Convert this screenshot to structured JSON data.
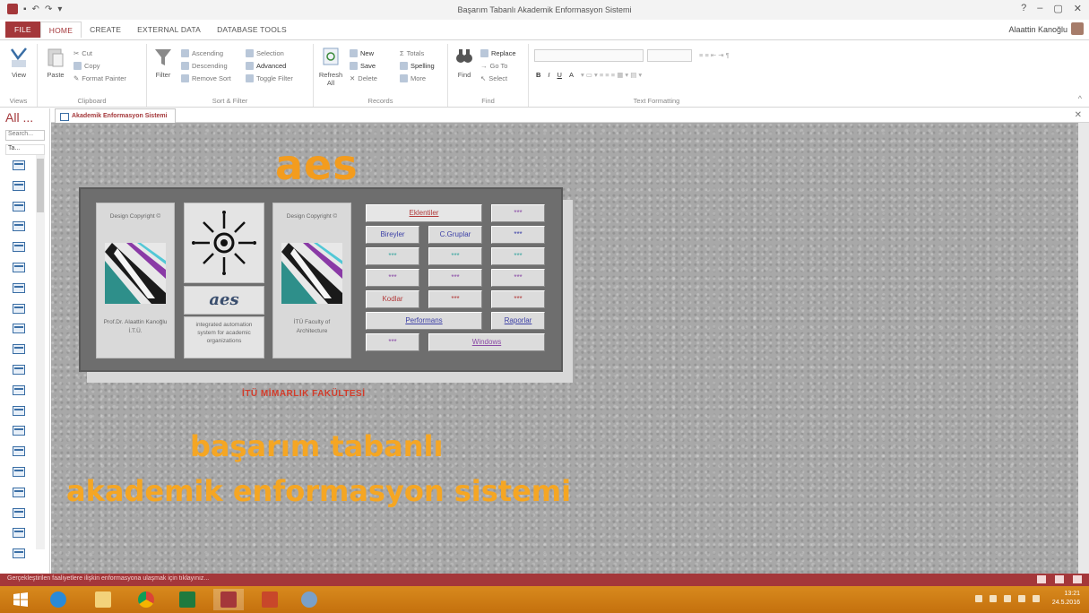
{
  "window": {
    "title": "Başarım Tabanlı Akademik Enformasyon Sistemi",
    "user": "Alaattin Kanoğlu",
    "controls": [
      "?",
      "–",
      "▢",
      "✕"
    ]
  },
  "ribbon_tabs": [
    "FILE",
    "HOME",
    "CREATE",
    "EXTERNAL DATA",
    "DATABASE TOOLS"
  ],
  "ribbon": {
    "views": {
      "view": "View",
      "label": "Views"
    },
    "clipboard": {
      "paste": "Paste",
      "cut": "Cut",
      "copy": "Copy",
      "format_painter": "Format Painter",
      "label": "Clipboard"
    },
    "sort_filter": {
      "filter": "Filter",
      "ascending": "Ascending",
      "descending": "Descending",
      "remove_sort": "Remove Sort",
      "selection": "Selection",
      "advanced": "Advanced",
      "toggle_filter": "Toggle Filter",
      "label": "Sort & Filter"
    },
    "records": {
      "refresh": "Refresh All",
      "new": "New",
      "save": "Save",
      "delete": "Delete",
      "totals": "Totals",
      "spelling": "Spelling",
      "more": "More",
      "label": "Records"
    },
    "find": {
      "find": "Find",
      "replace": "Replace",
      "goto": "Go To",
      "select": "Select",
      "label": "Find"
    },
    "text_formatting": {
      "bold": "B",
      "italic": "I",
      "underline": "U",
      "font_color": "A",
      "label": "Text Formatting"
    }
  },
  "nav": {
    "title": "All ...",
    "search_placeholder": "Search...",
    "group_label": "Ta...",
    "item_count": 20
  },
  "doc_tab": {
    "label": "Akademik Enformasyon Sistemi",
    "close": "✕"
  },
  "form": {
    "title": "aes",
    "card_left": {
      "top": "Design Copyright ©",
      "bottom": "Prof.Dr. Alaattin Kanoğlu İ.T.Ü."
    },
    "card_middle": {
      "logo_text": "aes",
      "bottom": "integrated automation system for academic organizations"
    },
    "card_right": {
      "top": "Design Copyright ©",
      "bottom": "İTÜ Faculty of Architecture"
    },
    "buttons": {
      "eklentiler": "Eklentiler",
      "btn_r1": "***",
      "bireyler": "Bireyler",
      "c_gruplar": "C.Gruplar",
      "btn_r2": "***",
      "btn_a": "***",
      "btn_b": "***",
      "btn_c": "***",
      "btn_d": "***",
      "btn_e": "***",
      "btn_f": "***",
      "kodlar": "Kodlar",
      "btn_g": "***",
      "btn_h": "***",
      "performans": "Performans",
      "raporlar": "Raporlar",
      "btn_i": "***",
      "windows": "Windows"
    },
    "faculty": "İTÜ MİMARLIK FAKÜLTESİ",
    "slogan_line1": "başarım tabanlı",
    "slogan_line2": "akademik enformasyon sistemi"
  },
  "status": {
    "text": "Gerçekleştirilen faaliyetlere ilişkin enformasyona ulaşmak için tıklayınız..."
  },
  "taskbar": {
    "clock_time": "13:21",
    "clock_date": "24.5.2016",
    "apps": [
      "start-icon",
      "ie-icon",
      "explorer-icon",
      "chrome-icon",
      "excel-icon",
      "access-icon",
      "powerpoint-icon",
      "media-icon"
    ]
  },
  "colors": {
    "access_red": "#a4373a",
    "aes_orange": "#f39c1e",
    "taskbar_orange": "#d88a1e"
  }
}
